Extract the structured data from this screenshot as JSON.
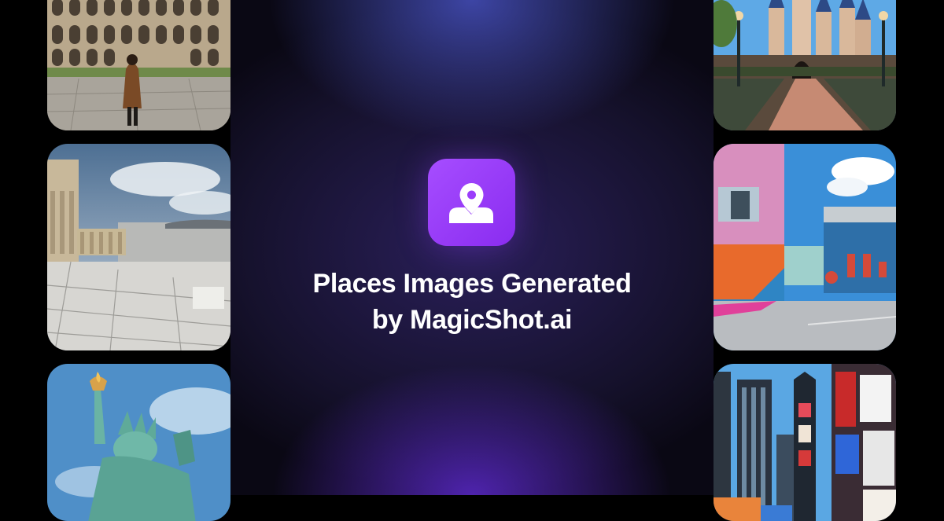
{
  "headline": {
    "line1": "Places Images Generated",
    "line2": "by MagicShot.ai"
  },
  "icon": {
    "name": "map-pin-user-icon",
    "color": "#9b3dfb"
  },
  "tiles": {
    "left": [
      "colosseum-photo",
      "acropolis-photo",
      "statue-of-liberty-photo"
    ],
    "right": [
      "fairytale-castle-photo",
      "colorful-street-photo",
      "times-square-photo"
    ]
  },
  "colors": {
    "accent": "#9b3dfb",
    "background": "#000000",
    "text": "#ffffff"
  }
}
